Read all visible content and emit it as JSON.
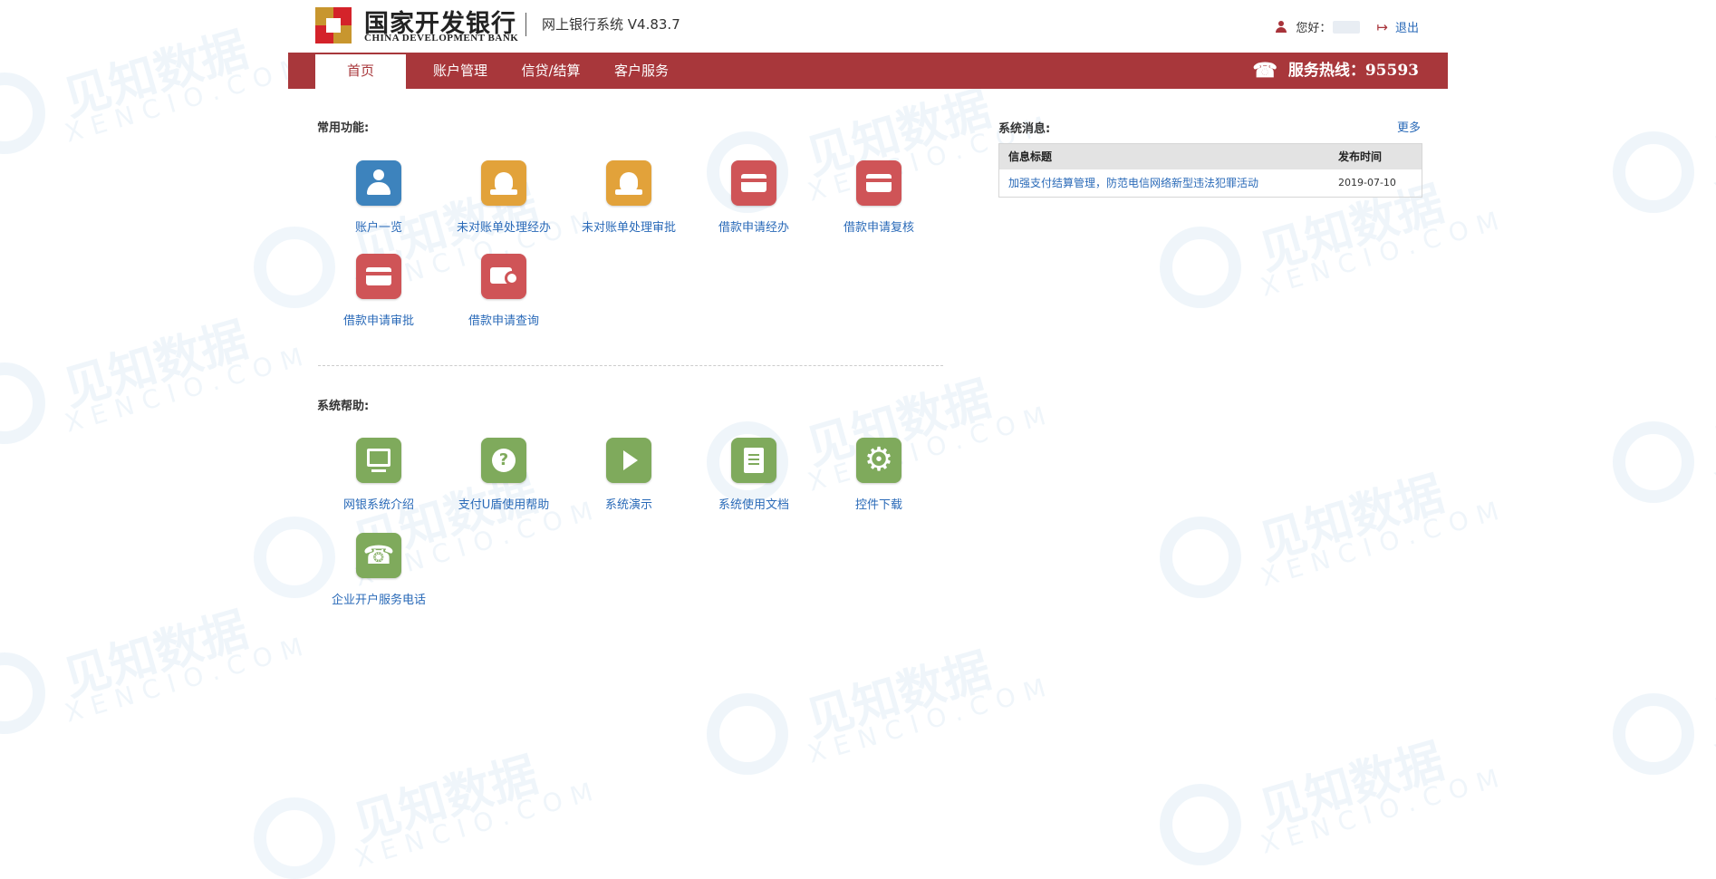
{
  "header": {
    "bank_name_cn": "国家开发银行",
    "bank_name_en": "CHINA DEVELOPMENT BANK",
    "system_name": "网上银行系统  V4.83.7",
    "greeting": "您好：",
    "logout_label": "退出"
  },
  "nav": {
    "items": [
      {
        "label": "首页",
        "active": true
      },
      {
        "label": "账户管理",
        "active": false
      },
      {
        "label": "信贷/结算",
        "active": false
      },
      {
        "label": "客户服务",
        "active": false
      }
    ],
    "hotline": "服务热线：95593"
  },
  "common_functions": {
    "title": "常用功能:",
    "items": [
      {
        "label": "账户一览",
        "icon": "user-icon",
        "color": "#3d83bd"
      },
      {
        "label": "未对账单处理经办",
        "icon": "money-bag-icon",
        "color": "#e2a23a"
      },
      {
        "label": "未对账单处理审批",
        "icon": "money-bag-check-icon",
        "color": "#e2a23a"
      },
      {
        "label": "借款申请经办",
        "icon": "loan-card-icon",
        "color": "#cf5457"
      },
      {
        "label": "借款申请复核",
        "icon": "loan-card-review-icon",
        "color": "#cf5457"
      },
      {
        "label": "借款申请审批",
        "icon": "loan-card-approve-icon",
        "color": "#cf5457"
      },
      {
        "label": "借款申请查询",
        "icon": "loan-search-icon",
        "color": "#cf5457"
      }
    ]
  },
  "system_help": {
    "title": "系统帮助:",
    "items": [
      {
        "label": "网银系统介绍",
        "icon": "monitor-icon",
        "color": "#7faa5c"
      },
      {
        "label": "支付U盾使用帮助",
        "icon": "help-icon",
        "color": "#7faa5c"
      },
      {
        "label": "系统演示",
        "icon": "play-icon",
        "color": "#7faa5c"
      },
      {
        "label": "系统使用文档",
        "icon": "document-icon",
        "color": "#7faa5c"
      },
      {
        "label": "控件下载",
        "icon": "gear-icon",
        "color": "#7faa5c"
      },
      {
        "label": "企业开户服务电话",
        "icon": "phone-icon",
        "color": "#7faa5c"
      }
    ]
  },
  "messages": {
    "title": "系统消息:",
    "more_label": "更多",
    "columns": [
      "信息标题",
      "发布时间"
    ],
    "rows": [
      {
        "title": "加强支付结算管理，防范电信网络新型违法犯罪活动",
        "date": "2019-07-10"
      }
    ]
  },
  "watermark": {
    "text": "见知数据",
    "sub": "XENCIO.COM"
  },
  "colors": {
    "brand_red": "#a8373b",
    "link_blue": "#2a6ab8",
    "icon_blue": "#3d83bd",
    "icon_orange": "#e2a23a",
    "icon_red": "#cf5457",
    "icon_green": "#7faa5c"
  }
}
